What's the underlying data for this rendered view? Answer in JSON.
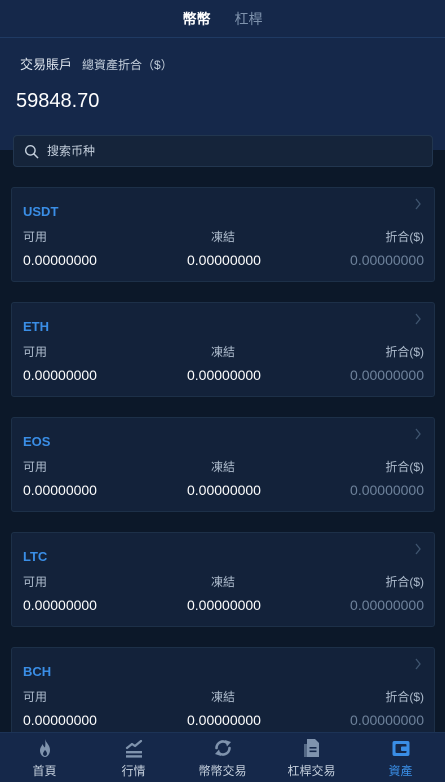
{
  "top_tabs": [
    {
      "label": "幣幣",
      "active": true
    },
    {
      "label": "杠桿",
      "active": false
    }
  ],
  "header": {
    "account_label": "交易賬戶",
    "total_label": "總資產折合（$）",
    "total_value": "59848.70"
  },
  "search": {
    "placeholder": "搜索币种",
    "icon": "search-icon"
  },
  "columns": {
    "available": "可用",
    "frozen": "凍結",
    "converted": "折合($)"
  },
  "assets": [
    {
      "name": "USDT",
      "available": "0.00000000",
      "frozen": "0.00000000",
      "converted": "0.00000000"
    },
    {
      "name": "ETH",
      "available": "0.00000000",
      "frozen": "0.00000000",
      "converted": "0.00000000"
    },
    {
      "name": "EOS",
      "available": "0.00000000",
      "frozen": "0.00000000",
      "converted": "0.00000000"
    },
    {
      "name": "LTC",
      "available": "0.00000000",
      "frozen": "0.00000000",
      "converted": "0.00000000"
    },
    {
      "name": "BCH",
      "available": "0.00000000",
      "frozen": "0.00000000",
      "converted": "0.00000000"
    }
  ],
  "bottom_nav": [
    {
      "label": "首頁",
      "icon": "flame-icon",
      "active": false
    },
    {
      "label": "行情",
      "icon": "chart-icon",
      "active": false
    },
    {
      "label": "幣幣交易",
      "icon": "exchange-icon",
      "active": false
    },
    {
      "label": "杠桿交易",
      "icon": "document-icon",
      "active": false
    },
    {
      "label": "資產",
      "icon": "wallet-icon",
      "active": true
    }
  ],
  "colors": {
    "accent": "#3a8ee6",
    "background": "#0c1829",
    "header": "#15284a",
    "card": "#13223a"
  }
}
